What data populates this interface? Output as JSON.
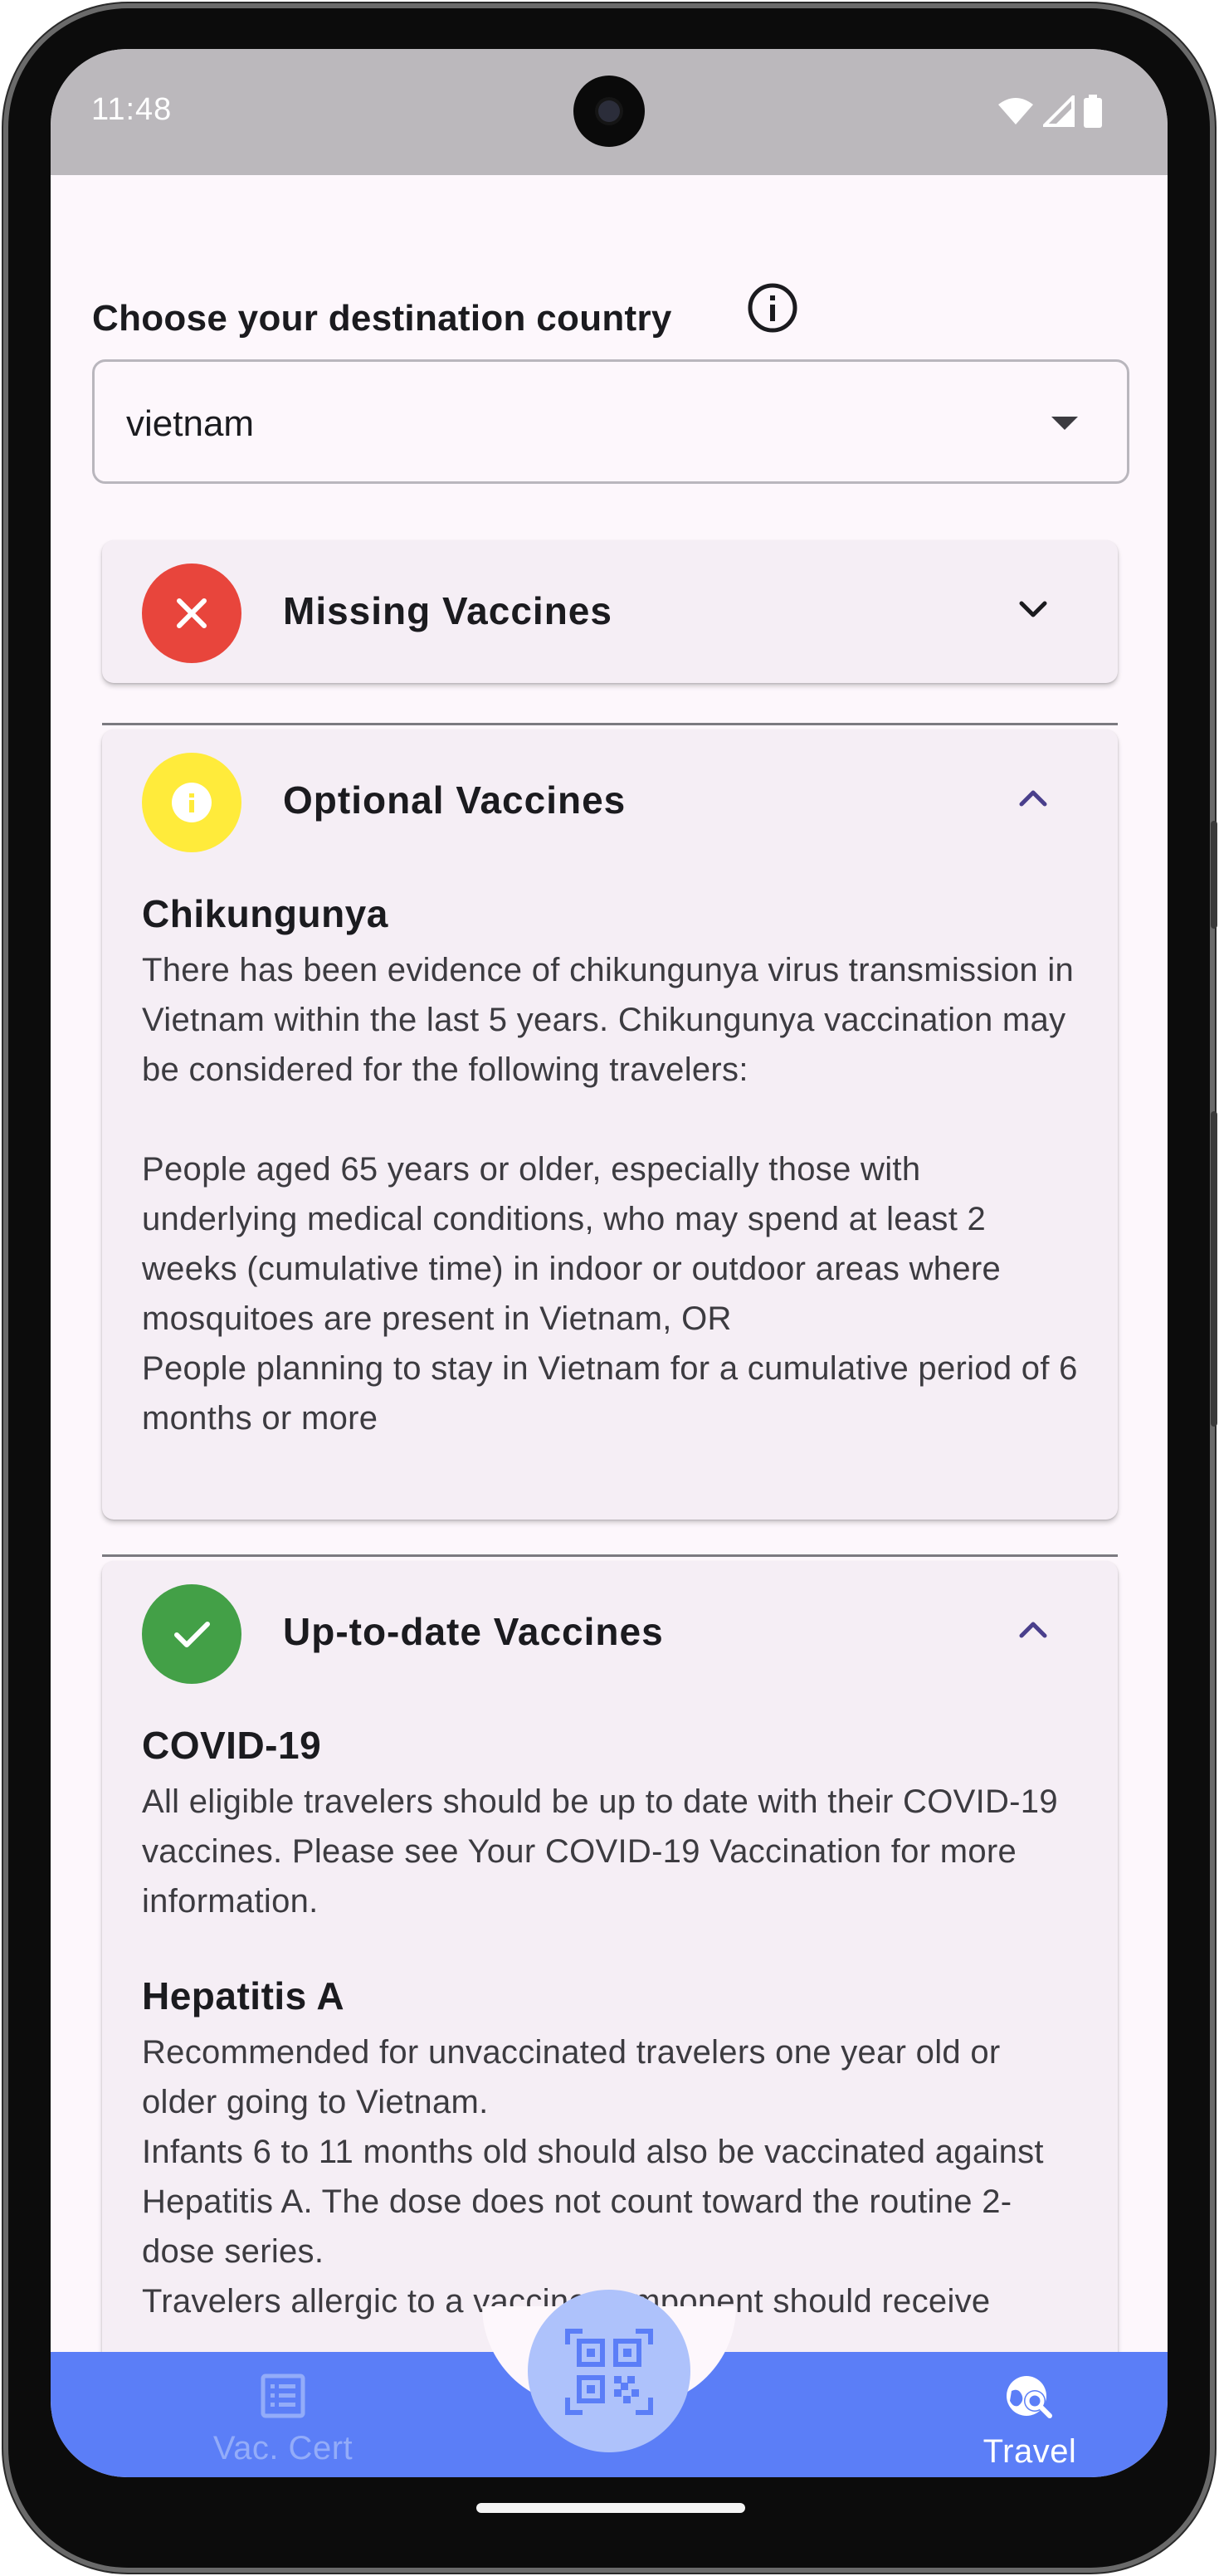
{
  "status_bar": {
    "time": "11:48",
    "icons": [
      "wifi-icon",
      "cellular-signal-icon",
      "battery-icon"
    ]
  },
  "destination": {
    "label": "Choose your destination country",
    "selected_country": "vietnam",
    "info_icon": "info-icon",
    "dropdown_icon": "dropdown-arrow-icon"
  },
  "sections": {
    "missing": {
      "title": "Missing Vaccines",
      "icon": "close-icon",
      "color": "#e8453c",
      "expanded": false
    },
    "optional": {
      "title": "Optional Vaccines",
      "icon": "info-icon",
      "color": "#ffeb3b",
      "expanded": true,
      "vaccines": [
        {
          "name": "Chikungunya",
          "description": "There has been evidence of chikungunya virus transmission in Vietnam within the last 5 years. Chikungunya vaccination may be considered for the following travelers:\n\nPeople aged 65 years or older, especially those with underlying medical conditions, who may spend at least 2 weeks (cumulative time) in indoor or outdoor areas where mosquitoes are present in Vietnam, OR\nPeople planning to stay in Vietnam for a cumulative period of 6 months or more"
        }
      ]
    },
    "uptodate": {
      "title": "Up-to-date Vaccines",
      "icon": "check-icon",
      "color": "#43a047",
      "expanded": true,
      "vaccines": [
        {
          "name": "COVID-19",
          "description": "All eligible travelers should be up to date with their COVID-19 vaccines. Please see Your COVID-19 Vaccination for more information."
        },
        {
          "name": "Hepatitis A",
          "description": "Recommended for unvaccinated travelers one year old or older going to Vietnam.\nInfants 6 to 11 months old should also be vaccinated against Hepatitis A. The dose does not count toward the routine 2-dose series.\nTravelers allergic to a vaccine component should receive"
        }
      ]
    }
  },
  "bottom_nav": {
    "items": [
      {
        "label": "Vac. Cert",
        "icon": "certificate-list-icon",
        "active": false
      },
      {
        "label": "Travel",
        "icon": "travel-globe-search-icon",
        "active": true
      }
    ],
    "fab_icon": "qr-code-scan-icon"
  },
  "colors": {
    "accent": "#5b7ef7",
    "fab": "#aec2fb",
    "chevron": "#4a3f8c"
  }
}
